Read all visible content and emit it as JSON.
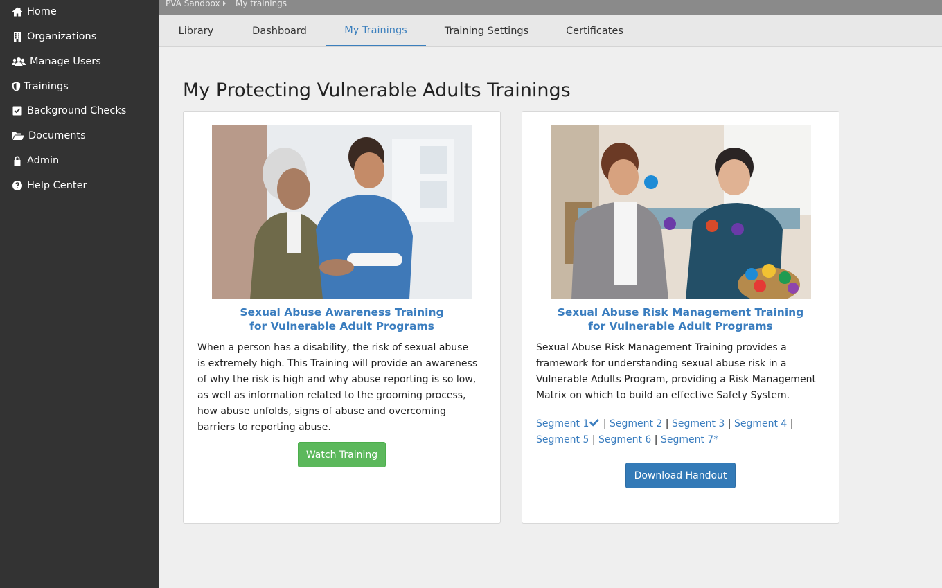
{
  "sidebar": {
    "items": [
      {
        "label": "Home",
        "icon": "home-icon"
      },
      {
        "label": "Organizations",
        "icon": "building-icon"
      },
      {
        "label": "Manage Users",
        "icon": "users-icon"
      },
      {
        "label": "Trainings",
        "icon": "shield-icon"
      },
      {
        "label": "Background Checks",
        "icon": "checkbox-icon"
      },
      {
        "label": "Documents",
        "icon": "folder-open-icon"
      },
      {
        "label": "Admin",
        "icon": "lock-icon"
      },
      {
        "label": "Help Center",
        "icon": "question-circle-icon"
      }
    ]
  },
  "breadcrumb": {
    "org": "PVA Sandbox",
    "page": "My trainings"
  },
  "tabs": [
    {
      "label": "Library"
    },
    {
      "label": "Dashboard"
    },
    {
      "label": "My Trainings",
      "active": true
    },
    {
      "label": "Training Settings"
    },
    {
      "label": "Certificates"
    }
  ],
  "main": {
    "title": "My Protecting Vulnerable Adults Trainings"
  },
  "cards": [
    {
      "title_line1": "Sexual Abuse Awareness Training",
      "title_line2": "for Vulnerable Adult Programs",
      "description": "When a person has a disability, the risk of sexual abuse is extremely high. This Training will provide an awareness of why the risk is high and why abuse reporting is so low, as well as information related to the grooming process, how abuse unfolds, signs of abuse and overcoming barriers to reporting abuse.",
      "button_label": "Watch Training"
    },
    {
      "title_line1": "Sexual Abuse Risk Management Training",
      "title_line2": "for Vulnerable Adult Programs",
      "description": "Sexual Abuse Risk Management Training provides a framework for understanding sexual abuse risk in a Vulnerable Adults Program, providing a Risk Management Matrix on which to build an effective Safety System.",
      "segments": [
        "Segment 1",
        "Segment 2",
        "Segment 3",
        "Segment 4",
        "Segment 5",
        "Segment 6",
        "Segment 7*"
      ],
      "segment_separator": "|",
      "button_label": "Download Handout"
    }
  ],
  "colors": {
    "sidebar_bg": "#333333",
    "accent": "#3b7fbd",
    "green_button": "#5cb85c",
    "blue_button": "#337ab7"
  }
}
